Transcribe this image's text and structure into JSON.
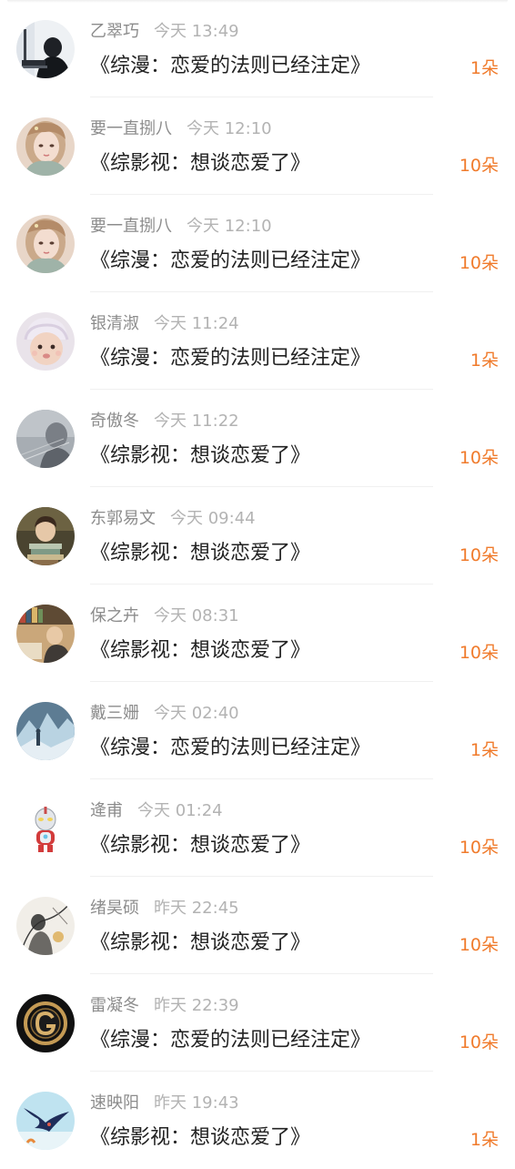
{
  "records": [
    {
      "user": "乙翠巧",
      "time": "今天 13:49",
      "book": "《综漫：恋爱的法则已经注定》",
      "amount": "1朵",
      "avatar": "dark-figure"
    },
    {
      "user": "要一直捌八",
      "time": "今天 12:10",
      "book": "《综影视：想谈恋爱了》",
      "amount": "10朵",
      "avatar": "anime-girl"
    },
    {
      "user": "要一直捌八",
      "time": "今天 12:10",
      "book": "《综漫：恋爱的法则已经注定》",
      "amount": "10朵",
      "avatar": "anime-girl"
    },
    {
      "user": "银清淑",
      "time": "今天 11:24",
      "book": "《综漫：恋爱的法则已经注定》",
      "amount": "1朵",
      "avatar": "baby"
    },
    {
      "user": "奇傲冬",
      "time": "今天 11:22",
      "book": "《综影视：想谈恋爱了》",
      "amount": "10朵",
      "avatar": "grey-portrait"
    },
    {
      "user": "东郭易文",
      "time": "今天 09:44",
      "book": "《综影视：想谈恋爱了》",
      "amount": "10朵",
      "avatar": "girl-books"
    },
    {
      "user": "保之卉",
      "time": "今天 08:31",
      "book": "《综影视：想谈恋爱了》",
      "amount": "10朵",
      "avatar": "bookshelf"
    },
    {
      "user": "戴三姗",
      "time": "今天 02:40",
      "book": "《综漫：恋爱的法则已经注定》",
      "amount": "1朵",
      "avatar": "ice-scene"
    },
    {
      "user": "逄甫",
      "time": "今天 01:24",
      "book": "《综影视：想谈恋爱了》",
      "amount": "10朵",
      "avatar": "ultraman"
    },
    {
      "user": "绪昊硕",
      "time": "昨天 22:45",
      "book": "《综影视：想谈恋爱了》",
      "amount": "10朵",
      "avatar": "sketch"
    },
    {
      "user": "雷凝冬",
      "time": "昨天 22:39",
      "book": "《综漫：恋爱的法则已经注定》",
      "amount": "10朵",
      "avatar": "g-logo"
    },
    {
      "user": "速映阳",
      "time": "昨天 19:43",
      "book": "《综影视：想谈恋爱了》",
      "amount": "1朵",
      "avatar": "swallow"
    }
  ]
}
